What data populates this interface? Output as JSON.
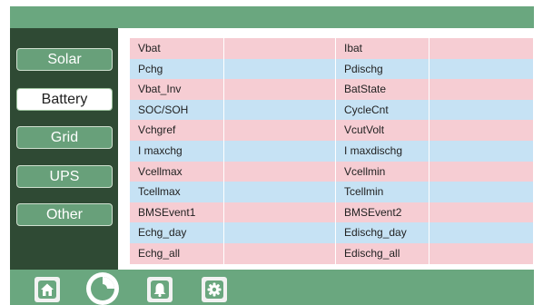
{
  "sidebar": {
    "items": [
      {
        "label": "Solar"
      },
      {
        "label": "Battery",
        "active": true
      },
      {
        "label": "Grid"
      },
      {
        "label": "UPS"
      },
      {
        "label": "Other"
      }
    ]
  },
  "table": {
    "rows": [
      {
        "left": "Vbat",
        "right": "Ibat"
      },
      {
        "left": "Pchg",
        "right": "Pdischg"
      },
      {
        "left": "Vbat_Inv",
        "right": "BatState"
      },
      {
        "left": "SOC/SOH",
        "right": "CycleCnt"
      },
      {
        "left": "Vchgref",
        "right": "VcutVolt"
      },
      {
        "left": "I maxchg",
        "right": "I maxdischg"
      },
      {
        "left": "Vcellmax",
        "right": "Vcellmin"
      },
      {
        "left": "Tcellmax",
        "right": "Tcellmin"
      },
      {
        "left": "BMSEvent1",
        "right": "BMSEvent2"
      },
      {
        "left": "Echg_day",
        "right": "Edischg_day"
      },
      {
        "left": "Echg_all",
        "right": "Edischg_all"
      }
    ]
  },
  "bottom_nav": [
    {
      "icon": "home-icon"
    },
    {
      "icon": "pie-chart-icon",
      "active": true
    },
    {
      "icon": "bell-icon"
    },
    {
      "icon": "gear-icon"
    }
  ],
  "colors": {
    "header_green": "#6aa77f",
    "sidebar_dark": "#2f4a34",
    "button_green": "#68a07a",
    "row_pink": "#f6cdd3",
    "row_blue": "#c6e2f4"
  }
}
